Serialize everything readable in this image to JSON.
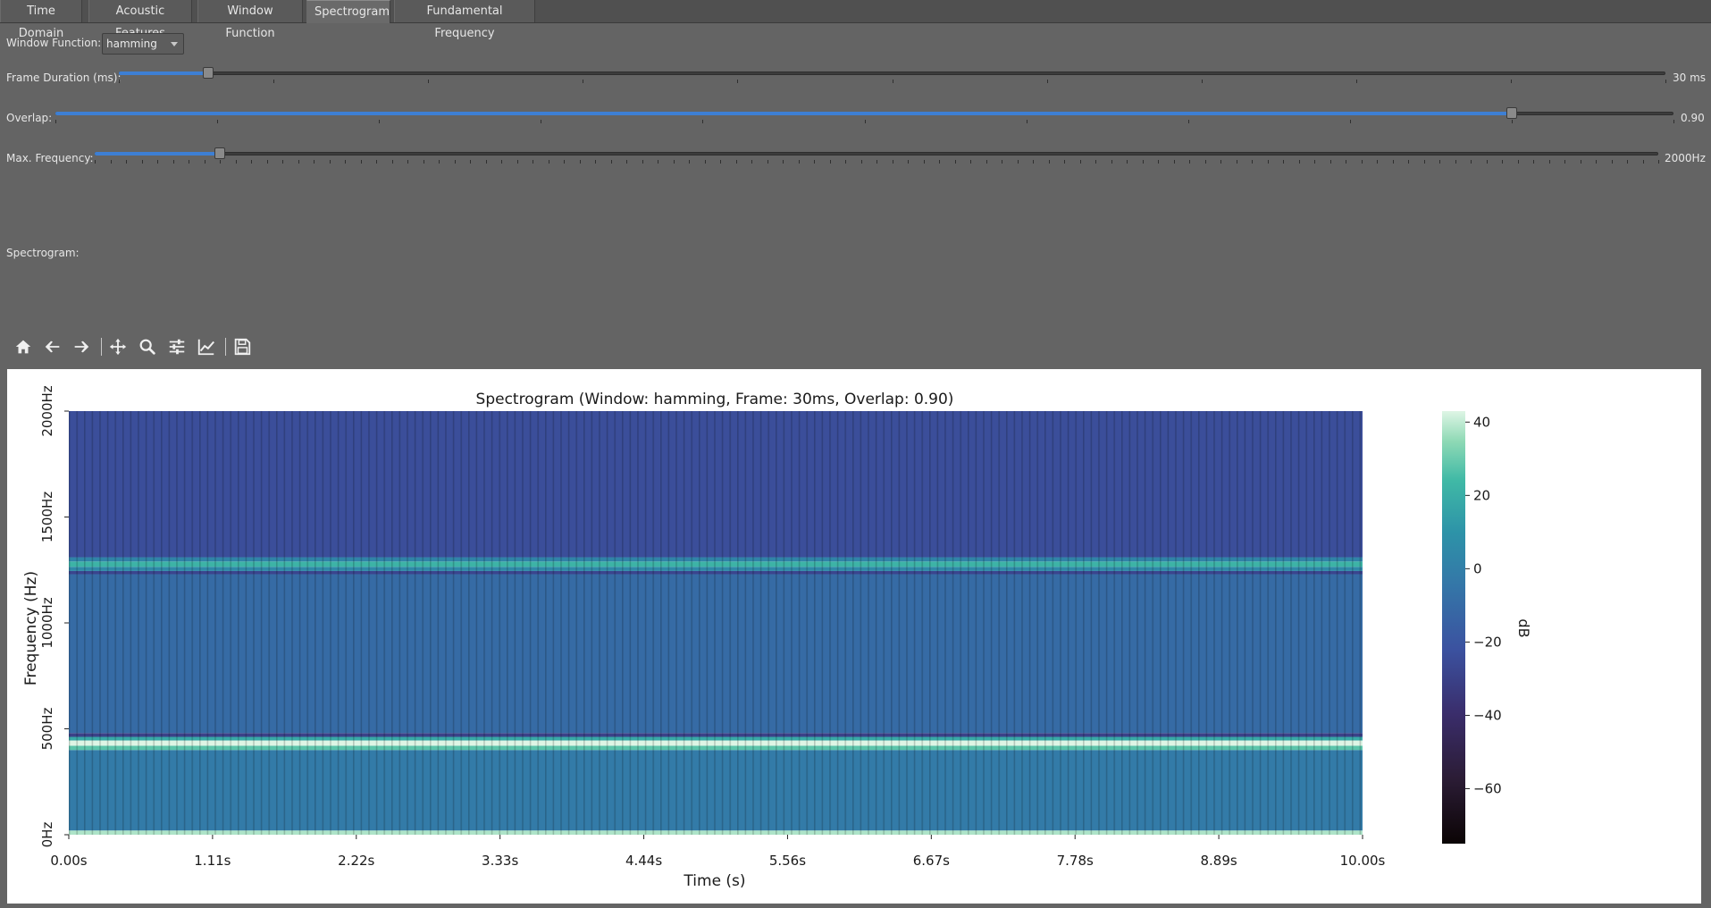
{
  "tabs": [
    {
      "label": "Time Domain",
      "active": false
    },
    {
      "label": "Acoustic Features",
      "active": false
    },
    {
      "label": "Window Function",
      "active": false
    },
    {
      "label": "Spectrogram",
      "active": true
    },
    {
      "label": "Fundamental Frequency",
      "active": false
    }
  ],
  "controls": {
    "window_function_label": "Window Function:",
    "window_function_value": "hamming",
    "frame_duration_label": "Frame Duration (ms):",
    "frame_duration_value": "30 ms",
    "frame_duration_fraction": 0.058,
    "overlap_label": "Overlap:",
    "overlap_value": "0.90",
    "overlap_fraction": 0.9,
    "max_frequency_label": "Max. Frequency:",
    "max_frequency_value": "2000Hz",
    "max_frequency_fraction": 0.08,
    "spectrogram_label": "Spectrogram:"
  },
  "toolbar": {
    "icons": [
      "home-icon",
      "back-arrow-icon",
      "forward-arrow-icon",
      "pan-icon",
      "zoom-icon",
      "configure-subplots-icon",
      "edit-axes-icon",
      "save-icon"
    ]
  },
  "chart_data": {
    "type": "heatmap",
    "title": "Spectrogram (Window: hamming, Frame: 30ms, Overlap: 0.90)",
    "xlabel": "Time (s)",
    "ylabel": "Frequency (Hz)",
    "xlim": [
      0,
      10
    ],
    "ylim": [
      0,
      2000
    ],
    "x_ticks": [
      "0.00s",
      "1.11s",
      "2.22s",
      "3.33s",
      "4.44s",
      "5.56s",
      "6.67s",
      "7.78s",
      "8.89s",
      "10.00s"
    ],
    "y_ticks": [
      "0Hz",
      "500Hz",
      "1000Hz",
      "1500Hz",
      "2000Hz"
    ],
    "colorbar": {
      "label": "dB",
      "range": [
        -75,
        43
      ],
      "ticks": [
        "40",
        "20",
        "0",
        "−20",
        "−40",
        "−60"
      ],
      "colormap": "mako",
      "tick_values": [
        40,
        20,
        0,
        -20,
        -40,
        -60
      ]
    },
    "frequency_bands": [
      {
        "from_hz": 0,
        "to_hz": 20,
        "db": 38
      },
      {
        "from_hz": 20,
        "to_hz": 400,
        "db": -2
      },
      {
        "from_hz": 400,
        "to_hz": 420,
        "db": 28
      },
      {
        "from_hz": 420,
        "to_hz": 445,
        "db": 43
      },
      {
        "from_hz": 445,
        "to_hz": 462,
        "db": 18
      },
      {
        "from_hz": 462,
        "to_hz": 480,
        "db": -30
      },
      {
        "from_hz": 480,
        "to_hz": 1230,
        "db": -10
      },
      {
        "from_hz": 1230,
        "to_hz": 1245,
        "db": -28
      },
      {
        "from_hz": 1245,
        "to_hz": 1265,
        "db": 5
      },
      {
        "from_hz": 1265,
        "to_hz": 1290,
        "db": 22
      },
      {
        "from_hz": 1290,
        "to_hz": 1310,
        "db": 2
      },
      {
        "from_hz": 1310,
        "to_hz": 2000,
        "db": -24
      }
    ]
  }
}
